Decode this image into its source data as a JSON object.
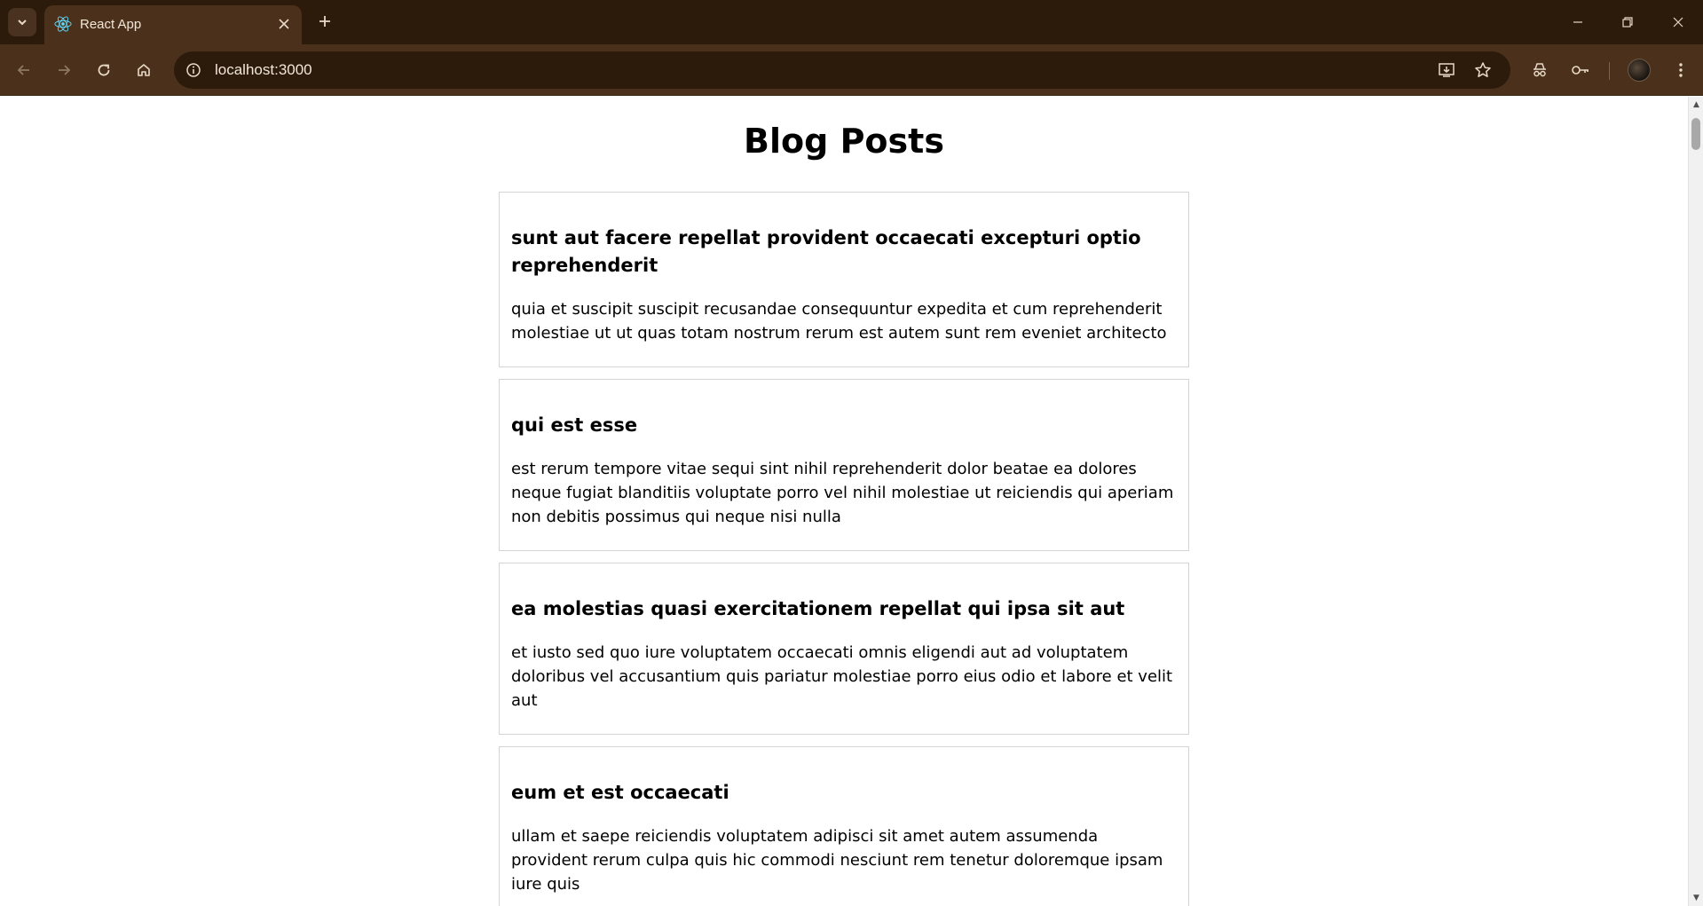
{
  "browser": {
    "tab_title": "React App",
    "url": "localhost:3000"
  },
  "icons": {
    "tab_search": "chevron-down-icon",
    "favicon": "react-logo-icon",
    "close": "close-icon",
    "new_tab": "plus-icon",
    "back": "arrow-left-icon",
    "forward": "arrow-right-icon",
    "reload": "reload-icon",
    "home": "home-icon",
    "site_info": "info-icon",
    "install": "install-app-icon",
    "bookmark": "star-icon",
    "incognito": "incognito-icon",
    "passwords": "key-icon",
    "menu": "kebab-menu-icon"
  },
  "colors": {
    "titlebar": "#2c1a0b",
    "toolbar": "#4b311c",
    "card_border": "#d4d4d4"
  },
  "page": {
    "heading": "Blog Posts",
    "posts": [
      {
        "title": "sunt aut facere repellat provident occaecati excepturi optio reprehenderit",
        "body": "quia et suscipit suscipit recusandae consequuntur expedita et cum reprehenderit molestiae ut ut quas totam nostrum rerum est autem sunt rem eveniet architecto"
      },
      {
        "title": "qui est esse",
        "body": "est rerum tempore vitae sequi sint nihil reprehenderit dolor beatae ea dolores neque fugiat blanditiis voluptate porro vel nihil molestiae ut reiciendis qui aperiam non debitis possimus qui neque nisi nulla"
      },
      {
        "title": "ea molestias quasi exercitationem repellat qui ipsa sit aut",
        "body": "et iusto sed quo iure voluptatem occaecati omnis eligendi aut ad voluptatem doloribus vel accusantium quis pariatur molestiae porro eius odio et labore et velit aut"
      },
      {
        "title": "eum et est occaecati",
        "body": "ullam et saepe reiciendis voluptatem adipisci sit amet autem assumenda provident rerum culpa quis hic commodi nesciunt rem tenetur doloremque ipsam iure quis"
      }
    ]
  }
}
